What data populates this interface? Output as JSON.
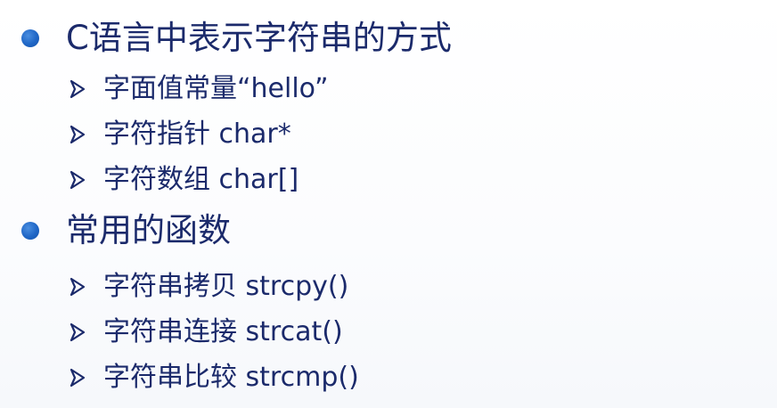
{
  "sections": [
    {
      "title": "C语言中表示字符串的方式",
      "items": [
        "字面值常量“hello”",
        "字符指针 char*",
        "字符数组 char[]"
      ]
    },
    {
      "title": "常用的函数",
      "items": [
        "字符串拷贝 strcpy()",
        "字符串连接 strcat()",
        "字符串比较 strcmp()"
      ]
    }
  ],
  "colors": {
    "text": "#1b2a6b",
    "bullet": "#1f66c6",
    "background": "#ffffff"
  },
  "icons": {
    "bullet": "filled-circle",
    "sub_bullet": "arrowhead-right"
  }
}
